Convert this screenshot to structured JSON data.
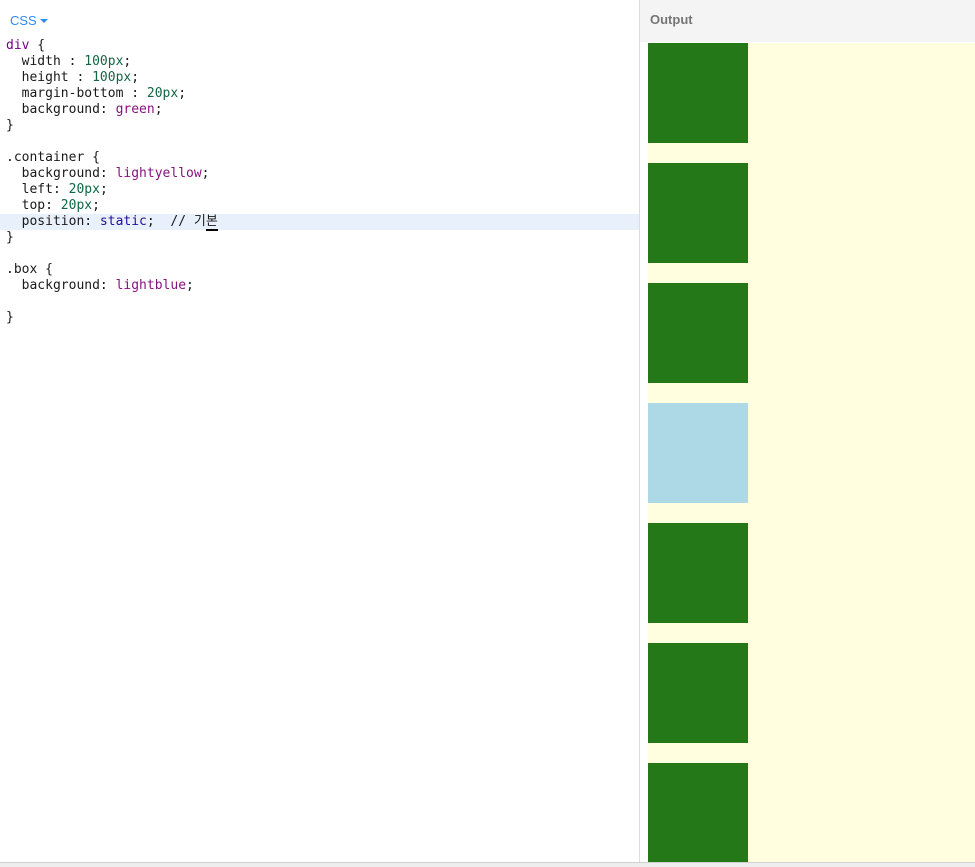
{
  "editor": {
    "language": "CSS",
    "code": [
      [
        {
          "t": "div",
          "c": "sel"
        },
        {
          "t": " {",
          "c": "prop"
        }
      ],
      [
        {
          "t": "  width : ",
          "c": "prop"
        },
        {
          "t": "100px",
          "c": "num"
        },
        {
          "t": ";",
          "c": "prop"
        }
      ],
      [
        {
          "t": "  height : ",
          "c": "prop"
        },
        {
          "t": "100px",
          "c": "num"
        },
        {
          "t": ";",
          "c": "prop"
        }
      ],
      [
        {
          "t": "  margin-bottom : ",
          "c": "prop"
        },
        {
          "t": "20px",
          "c": "num"
        },
        {
          "t": ";",
          "c": "prop"
        }
      ],
      [
        {
          "t": "  background: ",
          "c": "prop"
        },
        {
          "t": "green",
          "c": "kw"
        },
        {
          "t": ";",
          "c": "prop"
        }
      ],
      [
        {
          "t": "}",
          "c": "prop"
        }
      ],
      [],
      [
        {
          "t": ".container {",
          "c": "prop"
        }
      ],
      [
        {
          "t": "  background: ",
          "c": "prop"
        },
        {
          "t": "lightyellow",
          "c": "kw"
        },
        {
          "t": ";",
          "c": "prop"
        }
      ],
      [
        {
          "t": "  left: ",
          "c": "prop"
        },
        {
          "t": "20px",
          "c": "num"
        },
        {
          "t": ";",
          "c": "prop"
        }
      ],
      [
        {
          "t": "  top: ",
          "c": "prop"
        },
        {
          "t": "20px",
          "c": "num"
        },
        {
          "t": ";",
          "c": "prop"
        }
      ],
      [
        {
          "t": "  position: ",
          "c": "prop"
        },
        {
          "t": "static",
          "c": "atom"
        },
        {
          "t": ";  // 기",
          "c": "comment"
        },
        {
          "t": "본",
          "c": "cursor-u"
        }
      ],
      [
        {
          "t": "}",
          "c": "prop"
        }
      ],
      [],
      [
        {
          "t": ".box {",
          "c": "prop"
        }
      ],
      [
        {
          "t": "  background: ",
          "c": "prop"
        },
        {
          "t": "lightblue",
          "c": "kw"
        },
        {
          "t": ";",
          "c": "prop"
        }
      ],
      [],
      [
        {
          "t": "}",
          "c": "prop"
        }
      ]
    ],
    "active_line": 11
  },
  "output": {
    "title": "Output",
    "container_color": "#ffffe0",
    "boxes": [
      {
        "color": "#247818"
      },
      {
        "color": "#247818"
      },
      {
        "color": "#247818"
      },
      {
        "color": "#add8e6"
      },
      {
        "color": "#247818"
      },
      {
        "color": "#247818"
      },
      {
        "color": "#247818"
      }
    ]
  }
}
